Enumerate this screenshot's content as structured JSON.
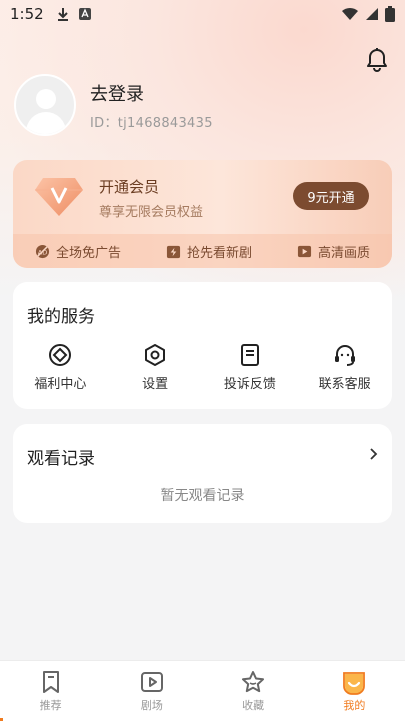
{
  "status_bar": {
    "time": "1:52"
  },
  "profile": {
    "login_text": "去登录",
    "user_id": "ID：tj1468843435"
  },
  "vip": {
    "title": "开通会员",
    "subtitle": "尊享无限会员权益",
    "button": "9元开通",
    "perks": [
      {
        "label": "全场免广告",
        "icon": "no-ads-icon"
      },
      {
        "label": "抢先看新剧",
        "icon": "lightning-icon"
      },
      {
        "label": "高清画质",
        "icon": "hd-icon"
      }
    ]
  },
  "services": {
    "title": "我的服务",
    "items": [
      {
        "label": "福利中心",
        "icon": "welfare-icon"
      },
      {
        "label": "设置",
        "icon": "settings-icon"
      },
      {
        "label": "投诉反馈",
        "icon": "feedback-icon"
      },
      {
        "label": "联系客服",
        "icon": "headset-icon"
      }
    ]
  },
  "history": {
    "title": "观看记录",
    "empty_text": "暂无观看记录"
  },
  "tabbar": {
    "tabs": [
      {
        "label": "推荐",
        "icon": "bookmark-icon"
      },
      {
        "label": "剧场",
        "icon": "play-icon"
      },
      {
        "label": "收藏",
        "icon": "star-icon"
      },
      {
        "label": "我的",
        "icon": "profile-icon"
      }
    ],
    "active_index": 3
  },
  "colors": {
    "accent": "#f07b1f",
    "vip_button": "#7c4b30",
    "vip_text": "#6b3d22"
  }
}
